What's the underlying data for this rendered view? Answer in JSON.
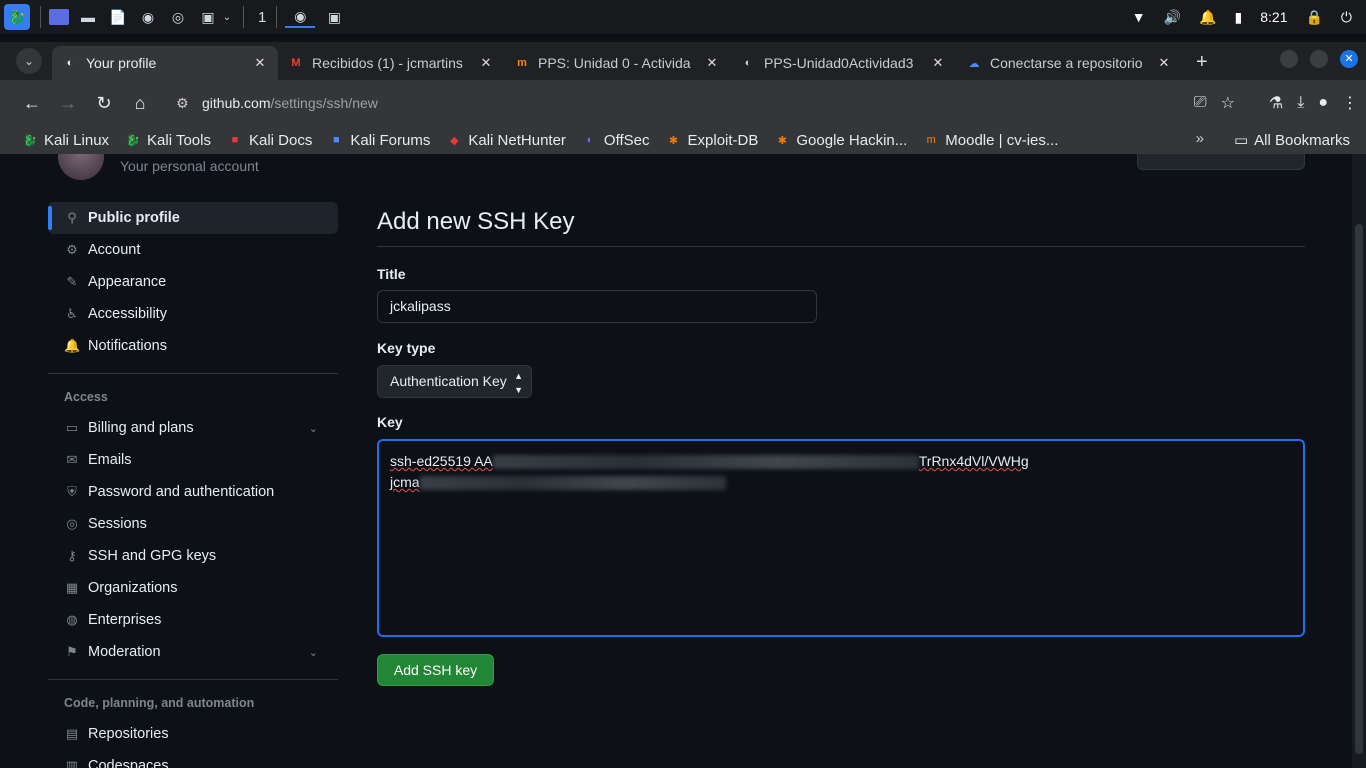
{
  "taskbar": {
    "workspace": "1",
    "time": "8:21"
  },
  "browser": {
    "tabs": [
      {
        "title": "Your profile",
        "icon": "github-icon",
        "active": true
      },
      {
        "title": "Recibidos (1) - jcmartins",
        "icon": "gmail-icon"
      },
      {
        "title": "PPS: Unidad 0 - Activida",
        "icon": "moodle-icon"
      },
      {
        "title": "PPS-Unidad0Actividad3",
        "icon": "github-icon"
      },
      {
        "title": "Conectarse a repositorio",
        "icon": "cloud-icon"
      }
    ],
    "url_host": "github.com",
    "url_path": "/settings/ssh/new",
    "bookmarks": [
      {
        "label": "Kali Linux",
        "icon": "kali-icon"
      },
      {
        "label": "Kali Tools",
        "icon": "kali-icon"
      },
      {
        "label": "Kali Docs",
        "icon": "kali-docs-icon"
      },
      {
        "label": "Kali Forums",
        "icon": "kali-forums-icon"
      },
      {
        "label": "Kali NetHunter",
        "icon": "nethunter-icon"
      },
      {
        "label": "OffSec",
        "icon": "offsec-icon"
      },
      {
        "label": "Exploit-DB",
        "icon": "exploitdb-icon"
      },
      {
        "label": "Google Hackin...",
        "icon": "ghdb-icon"
      },
      {
        "label": "Moodle | cv-ies...",
        "icon": "moodle-icon"
      }
    ],
    "all_bookmarks": "All Bookmarks"
  },
  "header": {
    "subtitle": "Your personal account"
  },
  "sidebar": {
    "items": [
      {
        "label": "Public profile",
        "icon": "person-icon",
        "active": true
      },
      {
        "label": "Account",
        "icon": "gear-icon"
      },
      {
        "label": "Appearance",
        "icon": "paintbrush-icon"
      },
      {
        "label": "Accessibility",
        "icon": "accessibility-icon"
      },
      {
        "label": "Notifications",
        "icon": "bell-icon"
      }
    ],
    "access_heading": "Access",
    "access_items": [
      {
        "label": "Billing and plans",
        "icon": "credit-card-icon",
        "expandable": true
      },
      {
        "label": "Emails",
        "icon": "mail-icon"
      },
      {
        "label": "Password and authentication",
        "icon": "shield-lock-icon"
      },
      {
        "label": "Sessions",
        "icon": "broadcast-icon"
      },
      {
        "label": "SSH and GPG keys",
        "icon": "key-icon"
      },
      {
        "label": "Organizations",
        "icon": "organization-icon"
      },
      {
        "label": "Enterprises",
        "icon": "globe-icon"
      },
      {
        "label": "Moderation",
        "icon": "report-icon",
        "expandable": true
      }
    ],
    "code_heading": "Code, planning, and automation",
    "code_items": [
      {
        "label": "Repositories",
        "icon": "repo-icon"
      },
      {
        "label": "Codespaces",
        "icon": "codespaces-icon"
      }
    ]
  },
  "form": {
    "heading": "Add new SSH Key",
    "title_label": "Title",
    "title_value": "jckalipass",
    "key_type_label": "Key type",
    "key_type_value": "Authentication Key",
    "key_label": "Key",
    "key_line1_start": "ssh-ed25519 AA",
    "key_line1_end": "TrRnx4dVl/VWHg",
    "key_line2_start": "jcma",
    "submit_label": "Add SSH key"
  },
  "colors": {
    "page_bg": "#0d1117",
    "accent_blue": "#2f81f7",
    "primary_green": "#238636"
  }
}
